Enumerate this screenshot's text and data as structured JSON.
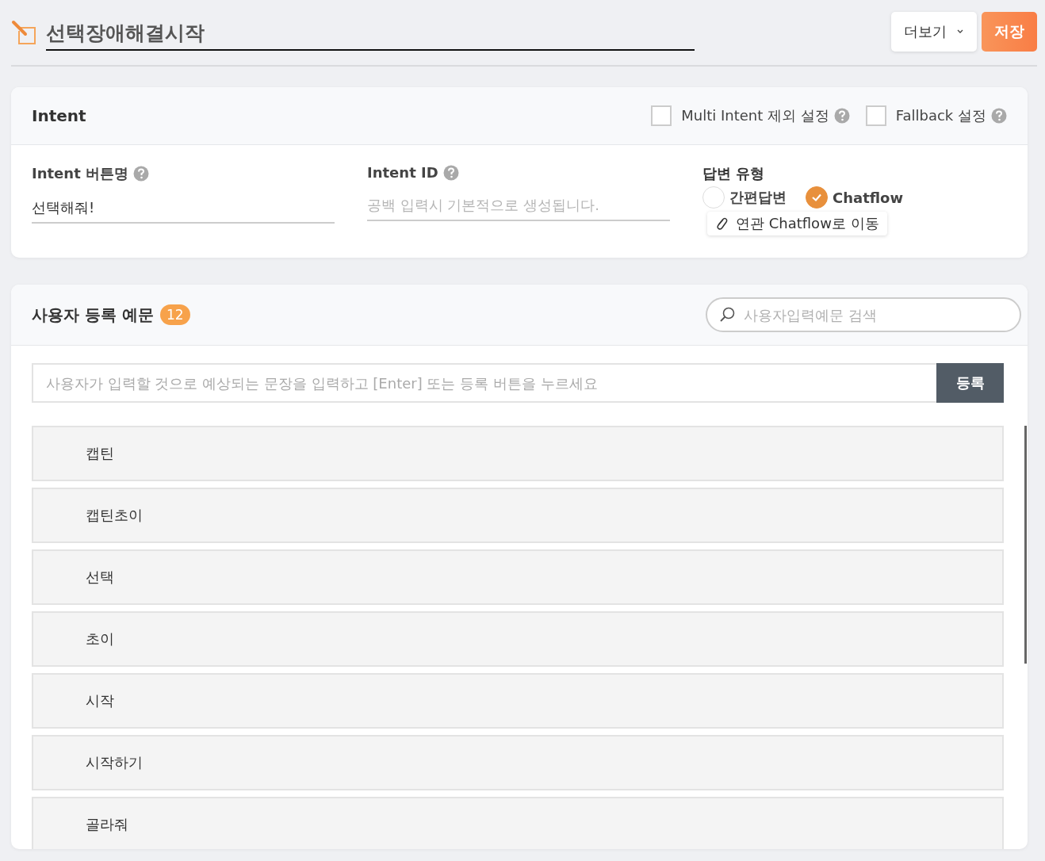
{
  "header": {
    "title": "선택장애해결시작",
    "more_button": "더보기",
    "save_button": "저장"
  },
  "intent": {
    "title": "Intent",
    "options": [
      {
        "label": "Multi Intent 제외 설정",
        "checked": false
      },
      {
        "label": "Fallback 설정",
        "checked": false
      }
    ],
    "button_name": {
      "label": "Intent 버튼명",
      "value": "선택해줘!"
    },
    "intent_id": {
      "label": "Intent ID",
      "placeholder": "공백 입력시 기본적으로 생성됩니다."
    },
    "answer_type": {
      "label": "답변 유형",
      "choices": [
        {
          "label": "간편답변",
          "selected": false
        },
        {
          "label": "Chatflow",
          "selected": true
        }
      ],
      "link": "연관 Chatflow로 이동"
    }
  },
  "examples": {
    "title": "사용자 등록 예문",
    "count": "12",
    "search_placeholder": "사용자입력예문 검색",
    "input_placeholder": "사용자가 입력할 것으로 예상되는 문장을 입력하고 [Enter] 또는 등록 버튼을 누르세요",
    "register_button": "등록",
    "items": [
      "캡틴",
      "캡틴초이",
      "선택",
      "초이",
      "시작",
      "시작하기",
      "골라줘"
    ]
  }
}
